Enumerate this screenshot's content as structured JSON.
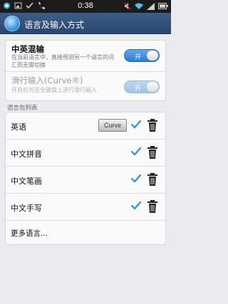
{
  "status_bar": {
    "time": "0:38",
    "left_icons": [
      "app-notification-icon",
      "image-notification-icon",
      "check-notification-icon",
      "phone-notification-icon"
    ],
    "right_icons": [
      "mute-icon",
      "wifi-icon",
      "signal-icon",
      "battery-icon"
    ]
  },
  "header": {
    "title": "语言及输入方式",
    "icon": "language-app-icon"
  },
  "options": [
    {
      "title": "中英混输",
      "desc": "在当前语言中，直接预测另一个语言的词汇而无需切换",
      "toggle_label": "开",
      "enabled": true
    },
    {
      "title": "滑行输入(Curve®)",
      "desc": "开启后可在全键盘上进行滑行输入",
      "toggle_label": "开",
      "enabled": false
    }
  ],
  "language_list": {
    "section_label": "语言包列表",
    "items": [
      {
        "name": "英语",
        "badge": "Curve",
        "checked": true
      },
      {
        "name": "中文拼音",
        "checked": true
      },
      {
        "name": "中文笔画",
        "checked": true
      },
      {
        "name": "中文手写",
        "checked": true
      }
    ],
    "more_label": "更多语言..."
  },
  "colors": {
    "titlebar": "#2b4670",
    "toggle_on": "#2f7ad3",
    "check": "#2d8fe0"
  }
}
